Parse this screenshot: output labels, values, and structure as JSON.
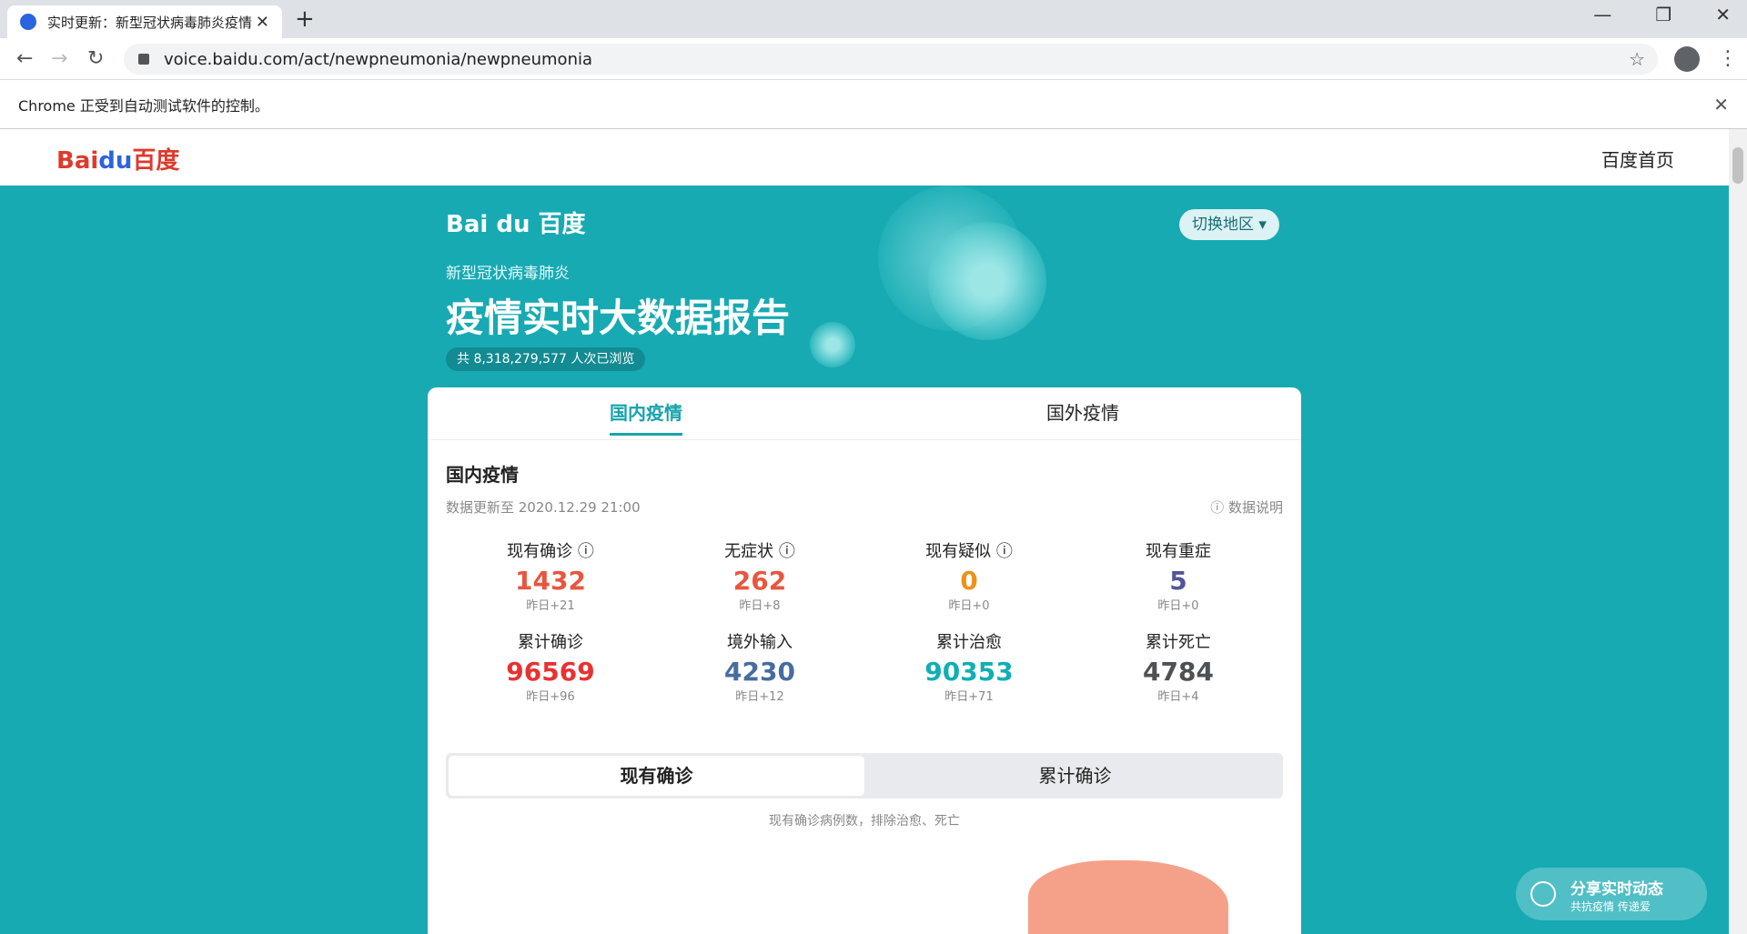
{
  "browser": {
    "tab_title": "实时更新：新型冠状病毒肺炎疫情",
    "url": "voice.baidu.com/act/newpneumonia/newpneumonia",
    "infobar": "Chrome 正受到自动测试软件的控制。"
  },
  "site": {
    "logo_bai": "Bai",
    "logo_du": "du",
    "logo_cn": "百度",
    "home": "百度首页"
  },
  "hero": {
    "logo": "Bai du 百度",
    "subtitle": "新型冠状病毒肺炎",
    "title": "疫情实时大数据报告",
    "views": "共 8,318,279,577 人次已浏览",
    "switch": "切换地区 ▾"
  },
  "tabs": {
    "domestic": "国内疫情",
    "foreign": "国外疫情"
  },
  "section": {
    "title": "国内疫情",
    "updated": "数据更新至 2020.12.29 21:00",
    "explain": "ⓘ 数据说明"
  },
  "stats": [
    {
      "label": "现有确诊 ⓘ",
      "value": "1432",
      "yest": "昨日+21",
      "color": "#e8563f"
    },
    {
      "label": "无症状 ⓘ",
      "value": "262",
      "yest": "昨日+8",
      "color": "#e8563f"
    },
    {
      "label": "现有疑似 ⓘ",
      "value": "0",
      "yest": "昨日+0",
      "color": "#ec9217"
    },
    {
      "label": "现有重症",
      "value": "5",
      "yest": "昨日+0",
      "color": "#545499"
    },
    {
      "label": "累计确诊",
      "value": "96569",
      "yest": "昨日+96",
      "color": "#e83132"
    },
    {
      "label": "境外输入",
      "value": "4230",
      "yest": "昨日+12",
      "color": "#476da0"
    },
    {
      "label": "累计治愈",
      "value": "90353",
      "yest": "昨日+71",
      "color": "#10aeb5"
    },
    {
      "label": "累计死亡",
      "value": "4784",
      "yest": "昨日+4",
      "color": "#4d5054"
    }
  ],
  "toggle": {
    "current": "现有确诊",
    "total": "累计确诊"
  },
  "note": "现有确诊病例数，排除治愈、死亡",
  "share": {
    "title": "分享实时动态",
    "sub": "共抗疫情 传递爱"
  }
}
